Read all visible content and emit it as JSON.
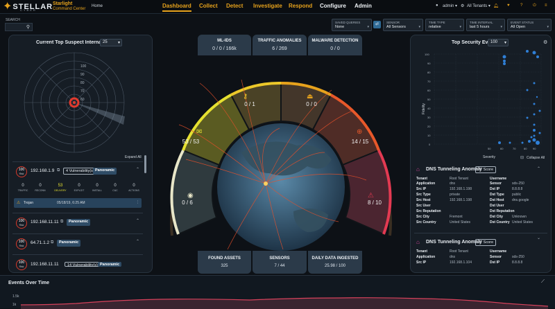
{
  "nav": {
    "logo_text": "STELLAR",
    "logo_sub": "CYBER",
    "brand_line1": "Starlight",
    "brand_line2": "Command Center",
    "home": "Home",
    "items": [
      "Dashboard",
      "Collect",
      "Detect",
      "Investigate",
      "Respond",
      "Configure",
      "Admin"
    ],
    "user": "admin ▾",
    "tenants": "All Tenants ▾"
  },
  "filters": {
    "search_label": "SEARCH",
    "saved_queries": {
      "label": "SAVED QUERIES",
      "value": "None"
    },
    "sensor": {
      "label": "SENSOR",
      "value": "All Sensors"
    },
    "time_type": {
      "label": "TIME TYPE",
      "value": "relative"
    },
    "time_interval": {
      "label": "TIME INTERVAL",
      "value": "last 5 hours"
    },
    "event_status": {
      "label": "EVENT STATUS",
      "value": "All Open"
    }
  },
  "left": {
    "title": "Current Top Suspect Internal Hosts",
    "count": "25",
    "radar_ticks": [
      "100",
      "90",
      "80",
      "70",
      "60"
    ],
    "expand_all": "Expand All",
    "hosts": [
      {
        "score": "100",
        "score_label": "Risk",
        "ip": "192.168.1.9",
        "vuln": "4 Vulnerability(s)",
        "button": "Panoramic"
      },
      {
        "score": "100",
        "score_label": "Risk",
        "ip": "192.168.11.11",
        "vuln": "",
        "button": "Panoramic"
      },
      {
        "score": "100",
        "score_label": "Risk",
        "ip": "64.71.1.2",
        "vuln": "",
        "button": "Panoramic"
      },
      {
        "score": "100",
        "score_label": "Risk",
        "ip": "192.168.11.11",
        "vuln": "14 Vulnerability(s)",
        "button": "Panoramic"
      }
    ],
    "stages": [
      {
        "value": "0",
        "label": "TRAFFIC"
      },
      {
        "value": "0",
        "label": "RECONN"
      },
      {
        "value": "53",
        "label": "DELIVERY"
      },
      {
        "value": "0",
        "label": "EXPLOIT"
      },
      {
        "value": "0",
        "label": "INSTALL"
      },
      {
        "value": "0",
        "label": "C&C"
      },
      {
        "value": "0",
        "label": "ACTIONS"
      }
    ],
    "trojan": {
      "name": "Trojan",
      "time": "05/18/19, 6:25 AM"
    }
  },
  "center": {
    "top_stats": [
      {
        "title": "ML-IDS",
        "value": "0 / 0 / 166k"
      },
      {
        "title": "TRAFFIC ANOMALIES",
        "value": "6 / 269"
      },
      {
        "title": "MALWARE DETECTION",
        "value": "0 / 0"
      }
    ],
    "gauge": {
      "segments": [
        {
          "value": "0 / 6",
          "color": "#e8e6c8"
        },
        {
          "value": "53 / 53",
          "color": "#e5e030"
        },
        {
          "value": "0 / 1",
          "color": "#ecc82a"
        },
        {
          "value": "0 / 0",
          "color": "#e6a21c"
        },
        {
          "value": "14 / 15",
          "color": "#e8582a"
        },
        {
          "value": "8 / 10",
          "color": "#e33a52"
        }
      ]
    },
    "bottom_stats": [
      {
        "title": "FOUND ASSETS",
        "value": "325"
      },
      {
        "title": "SENSORS",
        "value": "7 / 44"
      },
      {
        "title": "DAILY DATA INGESTED",
        "value": "25.98 / 100"
      }
    ]
  },
  "right": {
    "title": "Top Security Events",
    "count": "100",
    "scatter": {
      "xlabel": "Severity",
      "ylabel": "Fidelity",
      "x_ticks": [
        "50",
        "60",
        "70",
        "80",
        "90"
      ],
      "y_ticks": [
        "0",
        "10",
        "20",
        "30",
        "40",
        "50",
        "60",
        "70",
        "80",
        "90",
        "100"
      ]
    },
    "collapse_all": "Collapse All",
    "events": [
      {
        "title": "DNS Tunneling Anomaly",
        "score": "97 Score",
        "fields": [
          [
            "Tenant",
            "Root Tenant",
            "Username",
            ""
          ],
          [
            "Application",
            "dns",
            "Sensor",
            "sds-250"
          ],
          [
            "Src IP",
            "192.168.1.198",
            "Dst IP",
            "8.8.8.8"
          ],
          [
            "Src Type",
            "private",
            "Dst Type",
            "public"
          ],
          [
            "Src Host",
            "192.168.1.198",
            "Dst Host",
            "dns.google"
          ],
          [
            "Src User",
            "",
            "Dst User",
            ""
          ],
          [
            "Src Reputation",
            "",
            "Dst Reputation",
            ""
          ],
          [
            "Src City",
            "Fremont",
            "Dst City",
            "Unknown"
          ],
          [
            "Src Country",
            "United States",
            "Dst Country",
            "United States"
          ]
        ]
      },
      {
        "title": "DNS Tunneling Anomaly",
        "score": "97 Score",
        "fields": [
          [
            "Tenant",
            "Root Tenant",
            "Username",
            ""
          ],
          [
            "Application",
            "dns",
            "Sensor",
            "sds-250"
          ],
          [
            "Src IP",
            "192.168.1.104",
            "Dst IP",
            "8.8.8.8"
          ]
        ]
      }
    ]
  },
  "bottom": {
    "title": "Events Over Time",
    "y_ticks": [
      "1.5k",
      "1k"
    ]
  }
}
